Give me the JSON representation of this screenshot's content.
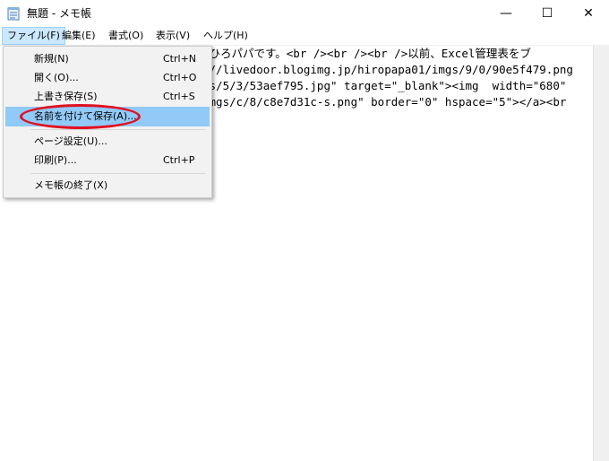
{
  "window": {
    "title": "無題 - メモ帳",
    "minimize_glyph": "—",
    "maximize_glyph": "☐",
    "close_glyph": "✕"
  },
  "menubar": {
    "items": [
      {
        "label": "ファイル(F)"
      },
      {
        "label": "編集(E)"
      },
      {
        "label": "書式(O)"
      },
      {
        "label": "表示(V)"
      },
      {
        "label": "ヘルプ(H)"
      }
    ]
  },
  "editor": {
    "lines": [
      ">ひろパパです。<br /><br /><br />以前、Excel管理表をブ",
      "://livedoor.blogimg.jp/hiropapa01/imgs/9/0/90e5f479.png",
      "gs/5/3/53aef795.jpg\" target=\"_blank\"><img  width=\"680\"",
      "imgs/c/8/c8e7d31c-s.png\" border=\"0\" hspace=\"5\"></a><br"
    ]
  },
  "file_menu": {
    "items": [
      {
        "label": "新規(N)",
        "shortcut": "Ctrl+N"
      },
      {
        "label": "開く(O)...",
        "shortcut": "Ctrl+O"
      },
      {
        "label": "上書き保存(S)",
        "shortcut": "Ctrl+S"
      },
      {
        "label": "名前を付けて保存(A)...",
        "shortcut": ""
      },
      {
        "label": "ページ設定(U)...",
        "shortcut": ""
      },
      {
        "label": "印刷(P)...",
        "shortcut": "Ctrl+P"
      },
      {
        "label": "メモ帳の終了(X)",
        "shortcut": ""
      }
    ],
    "highlight_color": "#91c9f7",
    "annotation_color": "#e01020"
  }
}
